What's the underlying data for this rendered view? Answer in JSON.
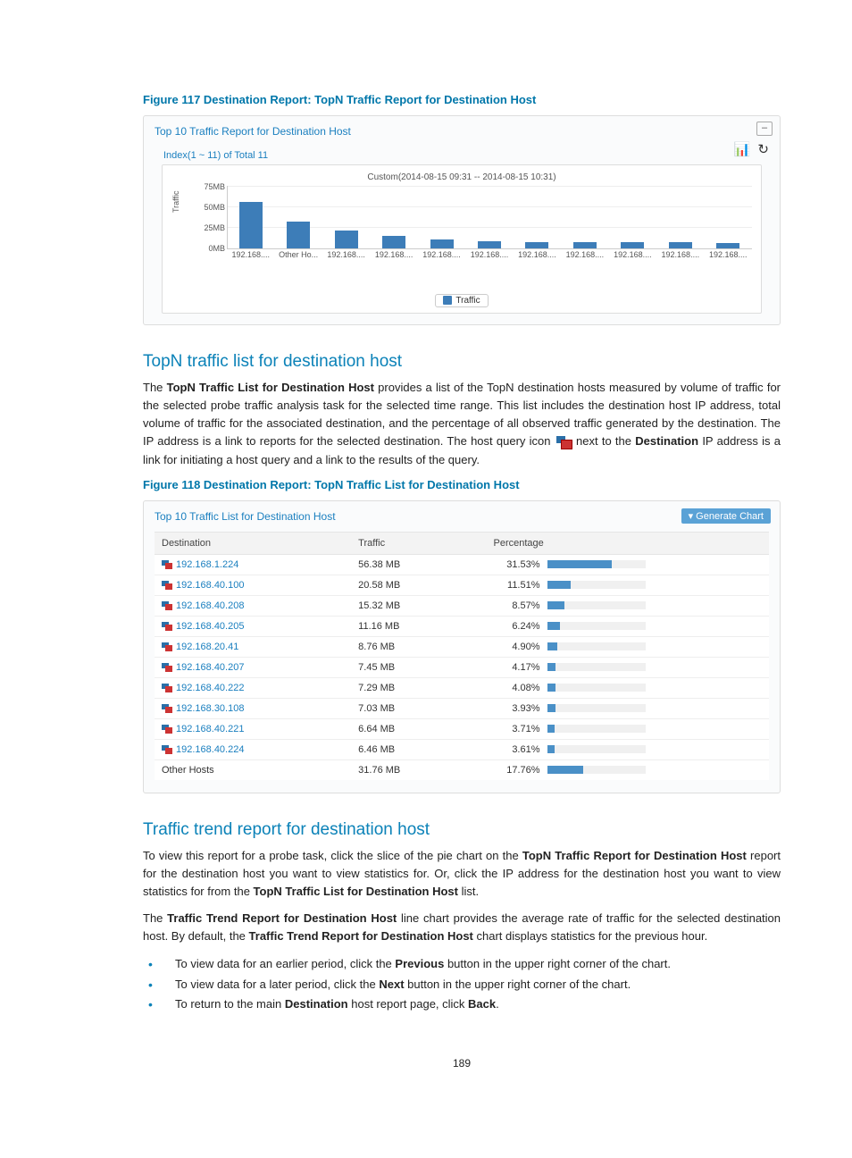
{
  "figure117_title": "Figure 117 Destination Report: TopN Traffic Report for Destination Host",
  "chart_panel": {
    "title": "Top 10 Traffic Report for Destination Host",
    "minimize": "–",
    "index_link": "Index(1 ~ 11) of Total 11",
    "caption": "Custom(2014-08-15 09:31 -- 2014-08-15 10:31)",
    "y_axis_label": "Traffic",
    "legend": "Traffic",
    "y_ticks": [
      "75MB",
      "50MB",
      "25MB",
      "0MB"
    ]
  },
  "chart_data": {
    "type": "bar",
    "title": "Top 10 Traffic Report for Destination Host",
    "xlabel": "",
    "ylabel": "Traffic",
    "ylim": [
      0,
      75
    ],
    "y_unit": "MB",
    "categories": [
      "192.168....",
      "Other Ho...",
      "192.168....",
      "192.168....",
      "192.168....",
      "192.168....",
      "192.168....",
      "192.168....",
      "192.168....",
      "192.168....",
      "192.168...."
    ],
    "values": [
      56,
      32,
      21,
      15,
      11,
      9,
      8,
      8,
      7,
      7,
      6
    ]
  },
  "section1_heading": "TopN traffic list for destination host",
  "section1_para_before": "The ",
  "section1_bold1": "TopN Traffic List for Destination Host",
  "section1_para_mid1": " provides a list of the TopN destination hosts measured by volume of traffic for the selected probe traffic analysis task for the selected time range. This list includes the destination host IP address, total volume of traffic for the associated destination, and the percentage of all observed traffic generated by the destination. The IP address is a link to reports for the selected destination. The host query icon ",
  "section1_para_mid2": " next to the ",
  "section1_bold2": "Destination",
  "section1_para_after": " IP address is a link for initiating a host query and a link to the results of the query.",
  "figure118_title": "Figure 118 Destination Report: TopN Traffic List for Destination Host",
  "list_panel": {
    "title": "Top 10 Traffic List for Destination Host",
    "generate_chart": "Generate Chart",
    "headers": {
      "dest": "Destination",
      "traffic": "Traffic",
      "pct": "Percentage"
    },
    "rows": [
      {
        "ip": "192.168.1.224",
        "traffic": "56.38 MB",
        "pct": "31.53%",
        "barPct": 31.53,
        "linked": true
      },
      {
        "ip": "192.168.40.100",
        "traffic": "20.58 MB",
        "pct": "11.51%",
        "barPct": 11.51,
        "linked": true
      },
      {
        "ip": "192.168.40.208",
        "traffic": "15.32 MB",
        "pct": "8.57%",
        "barPct": 8.57,
        "linked": true
      },
      {
        "ip": "192.168.40.205",
        "traffic": "11.16 MB",
        "pct": "6.24%",
        "barPct": 6.24,
        "linked": true
      },
      {
        "ip": "192.168.20.41",
        "traffic": "8.76 MB",
        "pct": "4.90%",
        "barPct": 4.9,
        "linked": true
      },
      {
        "ip": "192.168.40.207",
        "traffic": "7.45 MB",
        "pct": "4.17%",
        "barPct": 4.17,
        "linked": true
      },
      {
        "ip": "192.168.40.222",
        "traffic": "7.29 MB",
        "pct": "4.08%",
        "barPct": 4.08,
        "linked": true
      },
      {
        "ip": "192.168.30.108",
        "traffic": "7.03 MB",
        "pct": "3.93%",
        "barPct": 3.93,
        "linked": true
      },
      {
        "ip": "192.168.40.221",
        "traffic": "6.64 MB",
        "pct": "3.71%",
        "barPct": 3.71,
        "linked": true
      },
      {
        "ip": "192.168.40.224",
        "traffic": "6.46 MB",
        "pct": "3.61%",
        "barPct": 3.61,
        "linked": true
      },
      {
        "ip": "Other Hosts",
        "traffic": "31.76 MB",
        "pct": "17.76%",
        "barPct": 17.76,
        "linked": false
      }
    ]
  },
  "section2_heading": "Traffic trend report for destination host",
  "section2_p1_a": "To view this report for a probe task, click the slice of the pie chart on the ",
  "section2_p1_b1": "TopN Traffic Report for Destination Host",
  "section2_p1_b": " report for the destination host you want to view statistics for. Or, click the IP address for the destination host you want to view statistics for from the ",
  "section2_p1_b2": "TopN Traffic List for Destination Host",
  "section2_p1_c": " list.",
  "section2_p2_a": "The ",
  "section2_p2_b1": "Traffic Trend Report for Destination Host",
  "section2_p2_b": " line chart provides the average rate of traffic for the selected destination host. By default, the ",
  "section2_p2_b2": "Traffic Trend Report for Destination Host",
  "section2_p2_c": " chart displays statistics for the previous hour.",
  "bullets": {
    "b1_a": "To view data for an earlier period, click the ",
    "b1_bold": "Previous",
    "b1_b": " button in the upper right corner of the chart.",
    "b2_a": "To view data for a later period, click the ",
    "b2_bold": "Next",
    "b2_b": " button in the upper right corner of the chart.",
    "b3_a": "To return to the main ",
    "b3_bold": "Destination",
    "b3_b": " host report page, click ",
    "b3_bold2": "Back",
    "b3_c": "."
  },
  "page_number": "189"
}
